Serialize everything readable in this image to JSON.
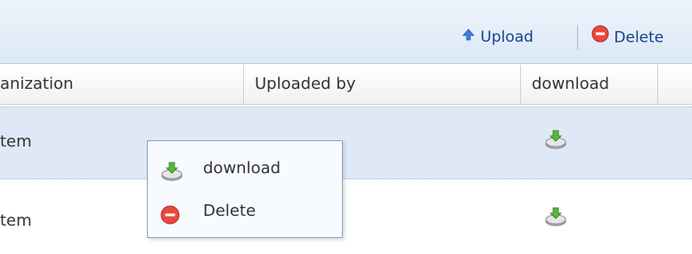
{
  "toolbar": {
    "upload_label": "Upload",
    "delete_label": "Delete",
    "upload_icon": "up-arrow-icon",
    "delete_icon": "minus-circle-icon"
  },
  "grid": {
    "columns": [
      "anization",
      "Uploaded by",
      "download",
      ""
    ],
    "rows": [
      {
        "organization": "tem",
        "uploaded_by": "",
        "download_icon": "download-icon"
      },
      {
        "organization": "tem",
        "uploaded_by": "",
        "download_icon": "download-icon"
      }
    ]
  },
  "context_menu": {
    "items": [
      {
        "label": "download",
        "icon": "download-icon"
      },
      {
        "label": "Delete",
        "icon": "minus-circle-icon"
      }
    ]
  },
  "colors": {
    "accent": "#15428b",
    "selected_row": "#dfe8f6",
    "delete_red": "#e8493a",
    "upload_blue": "#3d7fd6"
  }
}
